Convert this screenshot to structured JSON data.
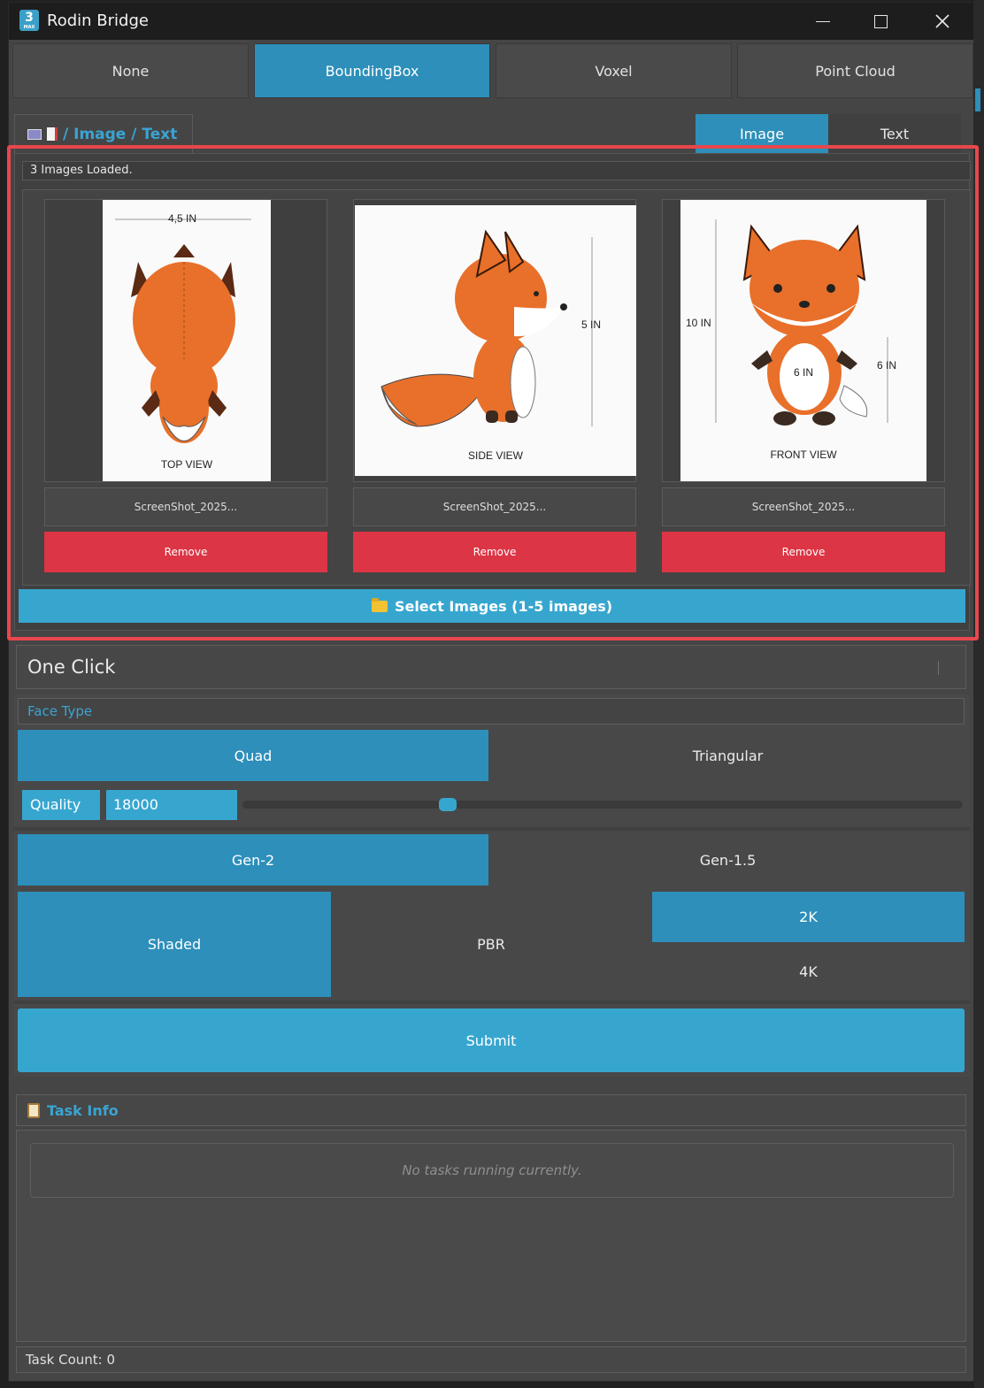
{
  "window": {
    "title": "Rodin Bridge",
    "app_icon_text": "3",
    "app_icon_sub": "MAX"
  },
  "top_tabs": [
    {
      "label": "None",
      "active": false
    },
    {
      "label": "BoundingBox",
      "active": true
    },
    {
      "label": "Voxel",
      "active": false
    },
    {
      "label": "Point Cloud",
      "active": false
    }
  ],
  "input_mode": {
    "label": "/ Image / Text",
    "tabs": [
      {
        "label": "Image",
        "active": true
      },
      {
        "label": "Text",
        "active": false
      }
    ]
  },
  "images": {
    "status": "3 Images Loaded.",
    "items": [
      {
        "filename": "ScreenShot_2025...",
        "remove_label": "Remove",
        "caption": "TOP VIEW",
        "dims": [
          "4,5 IN"
        ]
      },
      {
        "filename": "ScreenShot_2025...",
        "remove_label": "Remove",
        "caption": "SIDE VIEW",
        "dims": [
          "5 IN"
        ]
      },
      {
        "filename": "ScreenShot_2025...",
        "remove_label": "Remove",
        "caption": "FRONT VIEW",
        "dims": [
          "10 IN",
          "6 IN",
          "6 IN"
        ]
      }
    ],
    "select_label": "Select Images (1-5 images)"
  },
  "one_click": {
    "title": "One Click"
  },
  "face_type": {
    "label": "Face Type",
    "options": [
      {
        "label": "Quad",
        "active": true
      },
      {
        "label": "Triangular",
        "active": false
      }
    ]
  },
  "quality": {
    "label": "Quality",
    "value": "18000",
    "slider_fraction": 0.28
  },
  "generation": {
    "options": [
      {
        "label": "Gen-2",
        "active": true
      },
      {
        "label": "Gen-1.5",
        "active": false
      }
    ]
  },
  "material": {
    "options": [
      {
        "label": "Shaded",
        "active": true
      },
      {
        "label": "PBR",
        "active": false
      }
    ]
  },
  "resolution": {
    "options": [
      {
        "label": "2K",
        "active": true
      },
      {
        "label": "4K",
        "active": false
      }
    ]
  },
  "submit_label": "Submit",
  "task_info": {
    "title": "Task Info",
    "empty_message": "No tasks running currently.",
    "count_text": "Task Count: 0"
  },
  "colors": {
    "accent": "#2d8fba",
    "remove": "#dc3545",
    "highlight_frame": "#e8474d",
    "fox": "#e8702a"
  }
}
